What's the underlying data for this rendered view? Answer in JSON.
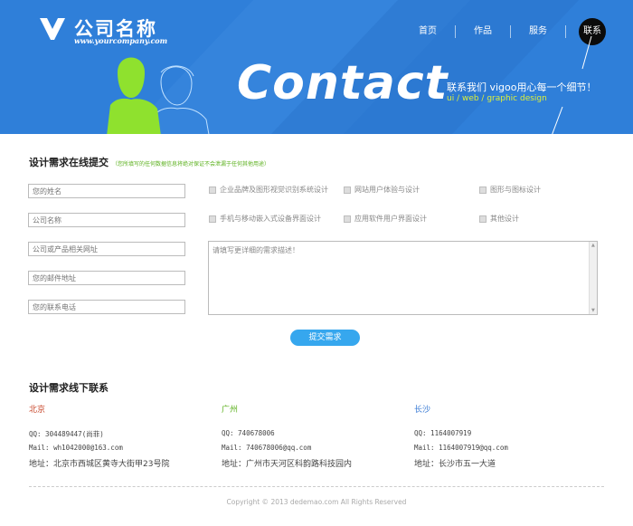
{
  "brand": {
    "name": "公司名称",
    "url": "www.yourcompany.com"
  },
  "nav": {
    "items": [
      "首页",
      "作品",
      "服务",
      "联系"
    ],
    "active": "联系"
  },
  "banner": {
    "title": "Contact",
    "slogan": "联系我们 vigoo用心每一个细节！",
    "subtitle": "ui / web / graphic design"
  },
  "form": {
    "heading": "设计需求在线提交",
    "note": "（您所填写的任何数据信息将绝对保证不会泄漏于任何其他用途）",
    "placeholders": {
      "name": "您的姓名",
      "company": "公司名称",
      "website": "公司或产品相关网址",
      "email": "您的邮件地址",
      "phone": "您的联系电话"
    },
    "checkboxes": [
      "企业品牌及图形视觉识别系统设计",
      "网站用户体验与设计",
      "图形与图标设计",
      "手机与移动嵌入式设备界面设计",
      "应用软件用户界面设计",
      "其他设计"
    ],
    "description_placeholder": "请填写更详细的需求描述！",
    "submit_label": "提交需求"
  },
  "offline": {
    "heading": "设计需求线下联系",
    "offices": [
      {
        "city": "北京",
        "city_color": "#c8462a",
        "qq": "QQ: 304489447(尚菲)",
        "mail": "Mail: wh1042000@163.com",
        "address": "地址：北京市西城区黄寺大街甲23号院"
      },
      {
        "city": "广州",
        "city_color": "#5cb11e",
        "qq": "QQ: 740678006",
        "mail": "Mail: 740678006@qq.com",
        "address": "地址：广州市天河区科韵路科技园内"
      },
      {
        "city": "长沙",
        "city_color": "#3a7bd5",
        "qq": "QQ: 1164007919",
        "mail": "Mail: 1164007919@qq.com",
        "address": "地址：长沙市五一大道"
      }
    ]
  },
  "footer": {
    "copyright": "Copyright © 2013 dedemao.com All Rights Reserved"
  },
  "colors": {
    "banner": "#2f7fd9",
    "accent_green": "#8fe12e",
    "submit": "#36a7ee"
  }
}
